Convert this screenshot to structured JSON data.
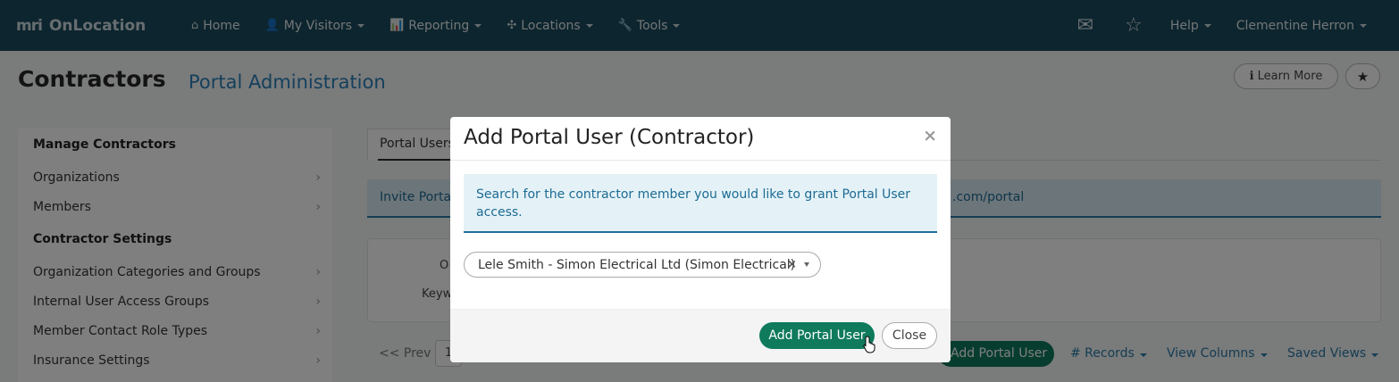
{
  "navbar": {
    "brand_logo": "mri",
    "brand_name": "OnLocation",
    "items": [
      {
        "label": "Home",
        "icon": "home-icon",
        "glyph": "⌂",
        "has_caret": false
      },
      {
        "label": "My Visitors",
        "icon": "user-icon",
        "glyph": "👤",
        "has_caret": true
      },
      {
        "label": "Reporting",
        "icon": "chart-icon",
        "glyph": "📊",
        "has_caret": true
      },
      {
        "label": "Locations",
        "icon": "locations-icon",
        "glyph": "✣",
        "has_caret": true
      },
      {
        "label": "Tools",
        "icon": "wrench-icon",
        "glyph": "🔧",
        "has_caret": true
      }
    ],
    "mail_icon": "✉",
    "star_icon": "☆",
    "help_label": "Help",
    "user_label": "Clementine Herron"
  },
  "page": {
    "title": "Contractors",
    "subtitle": "Portal Administration",
    "learn_more_label": "Learn More",
    "learn_more_icon": "ℹ",
    "star_icon": "★"
  },
  "sidebar": {
    "sections": [
      {
        "heading": "Manage Contractors",
        "items": [
          "Organizations",
          "Members"
        ]
      },
      {
        "heading": "Contractor Settings",
        "items": [
          "Organization Categories and Groups",
          "Internal User Access Groups",
          "Member Contact Role Types",
          "Insurance Settings"
        ]
      }
    ],
    "chevron": "›"
  },
  "main": {
    "tab_label": "Portal Users",
    "info_left": "Invite Portal",
    "info_right": ".com/portal",
    "filter_label_1": "O",
    "filter_label_2": "Keyw",
    "prev_label": "<< Prev",
    "page_value": "1",
    "add_button_label": "Add Portal User",
    "records_label": "# Records",
    "view_columns_label": "View Columns",
    "saved_views_label": "Saved Views"
  },
  "modal": {
    "title": "Add Portal User (Contractor)",
    "close_x": "×",
    "alert_text": "Search for the contractor member you would like to grant Portal User access.",
    "select_value": "Lele Smith - Simon Electrical Ltd (Simon Electrical)",
    "select_clear": "×",
    "primary_button": "Add Portal User",
    "close_button": "Close"
  },
  "colors": {
    "navbar_bg": "#1b4a5c",
    "primary_green": "#0f7a5c",
    "link_blue": "#2b80b8",
    "alert_bg": "#e4f2f7"
  }
}
